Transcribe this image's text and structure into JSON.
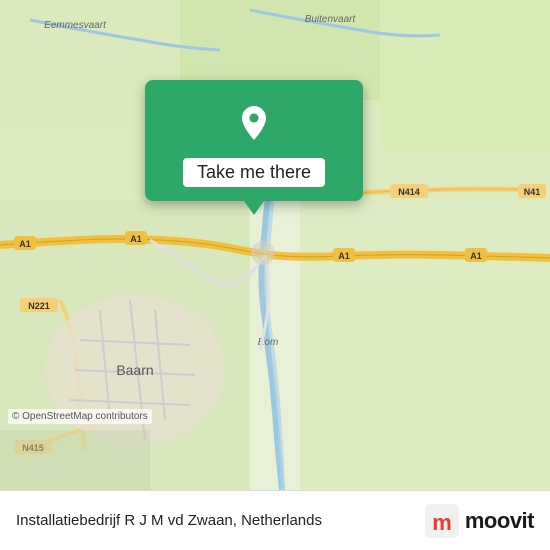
{
  "map": {
    "background_color": "#e8f0d8",
    "copyright": "© OpenStreetMap contributors"
  },
  "popup": {
    "button_label": "Take me there",
    "icon": "location-pin"
  },
  "bottom_bar": {
    "place_name": "Installatiebedrijf R J M vd Zwaan, Netherlands",
    "logo_text": "moovit"
  }
}
